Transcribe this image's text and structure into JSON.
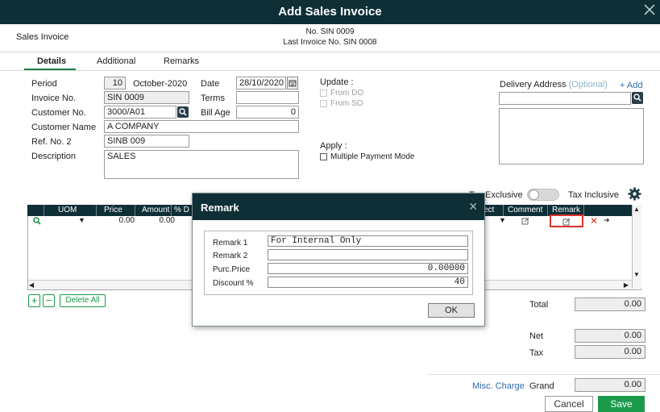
{
  "window": {
    "title": "Add Sales Invoice"
  },
  "header": {
    "doc_type": "Sales Invoice",
    "number_line": "No. SIN 0009",
    "last_invoice_line": "Last Invoice No. SIN 0008"
  },
  "tabs": [
    {
      "label": "Details",
      "active": true
    },
    {
      "label": "Additional",
      "active": false
    },
    {
      "label": "Remarks",
      "active": false
    }
  ],
  "form": {
    "period_label": "Period",
    "period_value": "10",
    "period_month": "October-2020",
    "invoice_no_label": "Invoice No.",
    "invoice_no_value": "SIN 0009",
    "customer_no_label": "Customer No.",
    "customer_no_value": "3000/A01",
    "customer_name_label": "Customer Name",
    "customer_name_value": "A COMPANY",
    "ref_no_label": "Ref. No. 2",
    "ref_no_value": "SINB 009",
    "description_label": "Description",
    "description_value": "SALES",
    "date_label": "Date",
    "date_value": "28/10/2020",
    "terms_label": "Terms",
    "terms_value": "",
    "bill_age_label": "Bill Age",
    "bill_age_value": "0"
  },
  "update": {
    "label": "Update :",
    "from_do": "From DO",
    "from_so": "From SO"
  },
  "apply": {
    "label": "Apply :",
    "multiple_payment": "Multiple Payment Mode"
  },
  "delivery": {
    "label": "Delivery Address",
    "optional": "(Optional)",
    "add_link": "+ Add",
    "value": ""
  },
  "tax": {
    "exclusive_label": "Tax Exclusive",
    "inclusive_label": "Tax Inclusive",
    "inclusive_on": false
  },
  "grid": {
    "columns": [
      "UOM",
      "Price",
      "Amount",
      "% D",
      "ect",
      "Comment",
      "Remark"
    ],
    "row": {
      "price": "0.00",
      "amount": "0.00"
    }
  },
  "grid_actions": {
    "add": "+",
    "remove": "−",
    "delete_all": "Delete All"
  },
  "dialog": {
    "title": "Remark",
    "remark1_label": "Remark 1",
    "remark1_value": "For Internal Only",
    "remark2_label": "Remark 2",
    "remark2_value": "",
    "purc_price_label": "Purc.Price",
    "purc_price_value": "0.00000",
    "discount_label": "Discount %",
    "discount_value": "40",
    "ok_label": "OK"
  },
  "totals": {
    "total_label": "Total",
    "total_value": "0.00",
    "net_label": "Net",
    "net_value": "0.00",
    "tax_label": "Tax",
    "tax_value": "0.00",
    "misc_charge_link": "Misc. Charge",
    "grand_label": "Grand",
    "grand_value": "0.00"
  },
  "footer": {
    "cancel_label": "Cancel",
    "save_label": "Save"
  },
  "colors": {
    "titlebar": "#0e2f36",
    "accent_green": "#1a9a4a",
    "link_blue": "#2b6cb0",
    "remark_highlight": "#d9342b"
  }
}
